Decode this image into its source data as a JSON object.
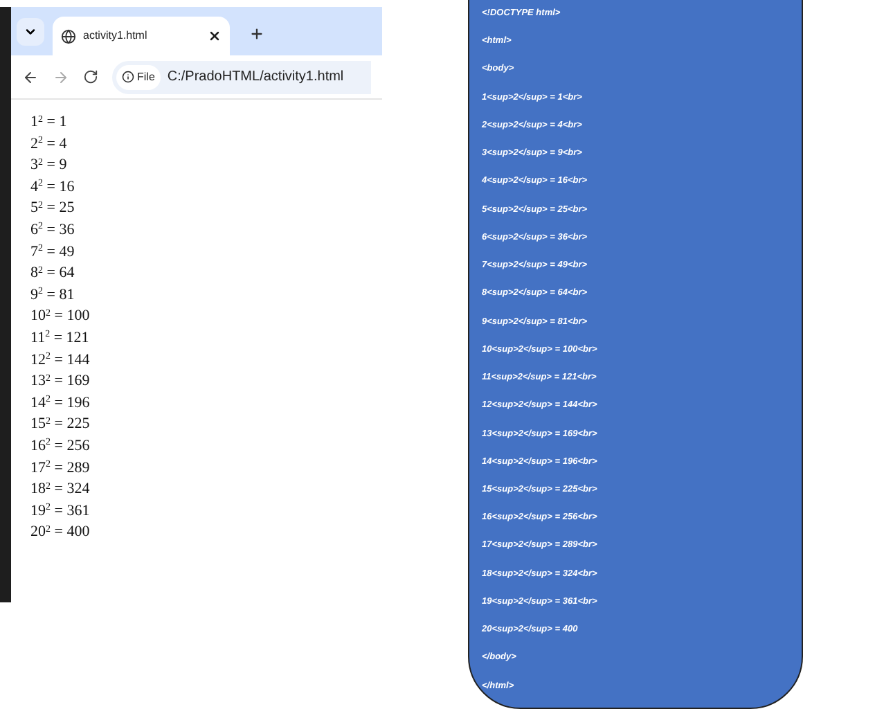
{
  "browser": {
    "tab": {
      "title": "activity1.html"
    },
    "address": {
      "scheme": "File",
      "url": "C:/PradoHTML/activity1.html"
    },
    "lines": [
      "1$^{2}$ = 1",
      "2$^{2}$ = 4",
      "3$^{2}$ = 9",
      "4$^{2}$ = 16",
      "5$^{2}$ = 25",
      "6$^{2}$ = 36",
      "7$^{2}$ = 49",
      "8$^{2}$ = 64",
      "9$^{2}$ = 81",
      "10$^{2}$ = 100",
      "11$^{2}$ = 121",
      "12$^{2}$ = 144",
      "13$^{2}$ = 169",
      "14$^{2}$ = 196",
      "15$^{2}$ = 225",
      "16$^{2}$ = 256",
      "17$^{2}$ = 289",
      "18$^{2}$ = 324",
      "19$^{2}$ = 361",
      "20$^{2}$ = 400"
    ]
  },
  "code_panel": {
    "lines": [
      "<!DOCTYPE html>",
      "<html>",
      "<body>",
      "1<sup>2</sup> = 1<br>",
      "2<sup>2</sup> = 4<br>",
      "3<sup>2</sup> = 9<br>",
      "4<sup>2</sup> = 16<br>",
      "5<sup>2</sup> = 25<br>",
      "6<sup>2</sup> = 36<br>",
      "7<sup>2</sup> = 49<br>",
      "8<sup>2</sup> = 64<br>",
      "9<sup>2</sup> = 81<br>",
      "10<sup>2</sup> = 100<br>",
      "11<sup>2</sup> = 121<br>",
      "12<sup>2</sup> = 144<br>",
      "13<sup>2</sup> = 169<br>",
      "14<sup>2</sup> = 196<br>",
      "15<sup>2</sup> = 225<br>",
      "16<sup>2</sup> = 256<br>",
      "17<sup>2</sup> = 289<br>",
      "18<sup>2</sup> = 324<br>",
      "19<sup>2</sup> = 361<br>",
      "20<sup>2</sup> = 400",
      "</body>",
      "</html>"
    ]
  }
}
